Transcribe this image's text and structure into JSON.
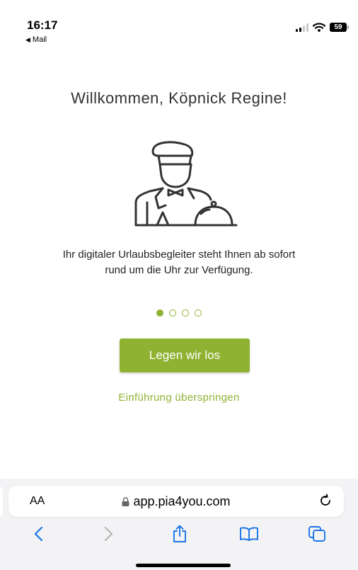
{
  "status_bar": {
    "time": "16:17",
    "back_label": "Mail",
    "battery": "59"
  },
  "welcome": {
    "title": "Willkommen, Köpnick Regine!"
  },
  "intro": {
    "line1": "Ihr digitaler Urlaubsbegleiter steht Ihnen ab sofort",
    "line2": "rund um die Uhr zur Verfügung."
  },
  "pager": {
    "count": 4,
    "active_index": 0
  },
  "actions": {
    "start_label": "Legen wir los",
    "skip_label": "Einführung überspringen"
  },
  "browser": {
    "text_size_label": "AA",
    "url": "app.pia4you.com"
  },
  "icons": [
    "back-arrow-icon",
    "mail-back-icon",
    "cellular-signal-icon",
    "wifi-icon",
    "battery-icon",
    "butler-illustration",
    "lock-icon",
    "reload-icon",
    "chevron-left-icon",
    "chevron-right-icon",
    "share-icon",
    "bookmarks-icon",
    "tabs-icon"
  ],
  "colors": {
    "accent": "#8fb233",
    "text": "#222222",
    "browser_bar": "#f3f3f5"
  }
}
